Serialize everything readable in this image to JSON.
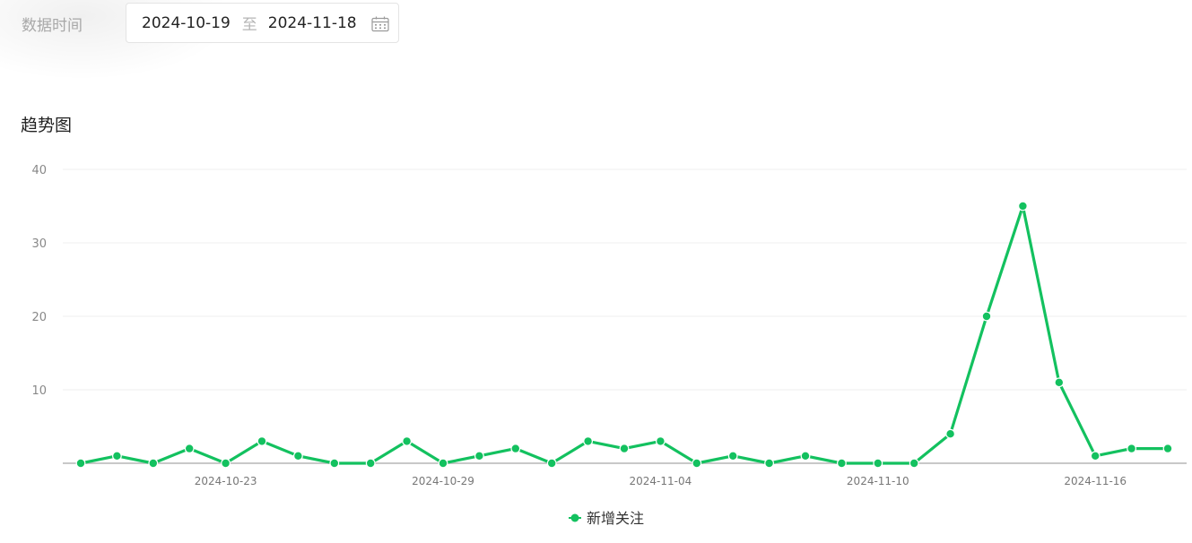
{
  "filter": {
    "label": "数据时间",
    "start_date": "2024-10-19",
    "separator": "至",
    "end_date": "2024-11-18"
  },
  "section_title": "趋势图",
  "chart_data": {
    "type": "line",
    "x": [
      "2024-10-19",
      "2024-10-20",
      "2024-10-21",
      "2024-10-22",
      "2024-10-23",
      "2024-10-24",
      "2024-10-25",
      "2024-10-26",
      "2024-10-27",
      "2024-10-28",
      "2024-10-29",
      "2024-10-30",
      "2024-10-31",
      "2024-11-01",
      "2024-11-02",
      "2024-11-03",
      "2024-11-04",
      "2024-11-05",
      "2024-11-06",
      "2024-11-07",
      "2024-11-08",
      "2024-11-09",
      "2024-11-10",
      "2024-11-11",
      "2024-11-12",
      "2024-11-13",
      "2024-11-14",
      "2024-11-15",
      "2024-11-16",
      "2024-11-17",
      "2024-11-18"
    ],
    "x_tick_labels": [
      "2024-10-23",
      "2024-10-29",
      "2024-11-04",
      "2024-11-10",
      "2024-11-16"
    ],
    "y_ticks": [
      10,
      20,
      30,
      40
    ],
    "ylim": [
      0,
      40
    ],
    "series": [
      {
        "name": "新增关注",
        "color": "#13c15f",
        "values": [
          0,
          1,
          0,
          2,
          0,
          3,
          1,
          0,
          0,
          3,
          0,
          1,
          2,
          0,
          3,
          2,
          3,
          0,
          1,
          0,
          1,
          0,
          0,
          0,
          4,
          20,
          35,
          11,
          1,
          2,
          2
        ]
      }
    ],
    "grid": "horizontal",
    "legend_position": "bottom-center"
  }
}
